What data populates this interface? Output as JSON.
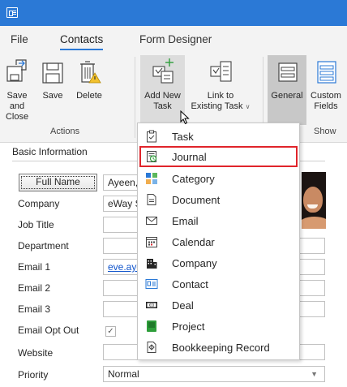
{
  "menubar": {
    "tabs": [
      {
        "label": "File"
      },
      {
        "label": "Contacts"
      },
      {
        "label": "Form Designer"
      }
    ]
  },
  "ribbon": {
    "buttons": [
      {
        "label": "Save and\nClose"
      },
      {
        "label": "Save"
      },
      {
        "label": "Delete"
      },
      {
        "label": "Add New\nTask"
      },
      {
        "label": "Link to\nExisting Task"
      },
      {
        "label": "General"
      },
      {
        "label": "Custom\nFields"
      }
    ],
    "groups": [
      {
        "label": "Actions"
      },
      {
        "label": "Show"
      }
    ]
  },
  "form": {
    "section_title": "Basic Information",
    "full_name_button": "Full Name",
    "full_name_value": "Ayeen,",
    "fields": [
      {
        "label": "Company",
        "value": "eWay S"
      },
      {
        "label": "Job Title",
        "value": ""
      },
      {
        "label": "Department",
        "value": ""
      },
      {
        "label": "Email 1",
        "value": "eve.aye"
      },
      {
        "label": "Email 2",
        "value": ""
      },
      {
        "label": "Email 3",
        "value": ""
      },
      {
        "label": "Email Opt Out",
        "value": "✓"
      },
      {
        "label": "Website",
        "value": ""
      },
      {
        "label": "Priority",
        "value": "Normal"
      }
    ]
  },
  "dropdown": {
    "items": [
      {
        "label": "Task",
        "icon": "clipboard-icon"
      },
      {
        "label": "Journal",
        "icon": "journal-icon"
      },
      {
        "label": "Category",
        "icon": "category-icon"
      },
      {
        "label": "Document",
        "icon": "document-icon"
      },
      {
        "label": "Email",
        "icon": "envelope-icon"
      },
      {
        "label": "Calendar",
        "icon": "calendar-icon"
      },
      {
        "label": "Company",
        "icon": "building-icon"
      },
      {
        "label": "Contact",
        "icon": "contact-card-icon"
      },
      {
        "label": "Deal",
        "icon": "deal-icon"
      },
      {
        "label": "Project",
        "icon": "project-icon"
      },
      {
        "label": "Bookkeeping Record",
        "icon": "bookkeeping-icon"
      }
    ]
  },
  "colors": {
    "titlebar": "#2b79d6",
    "highlight": "#e0242b",
    "link": "#1155cc"
  }
}
